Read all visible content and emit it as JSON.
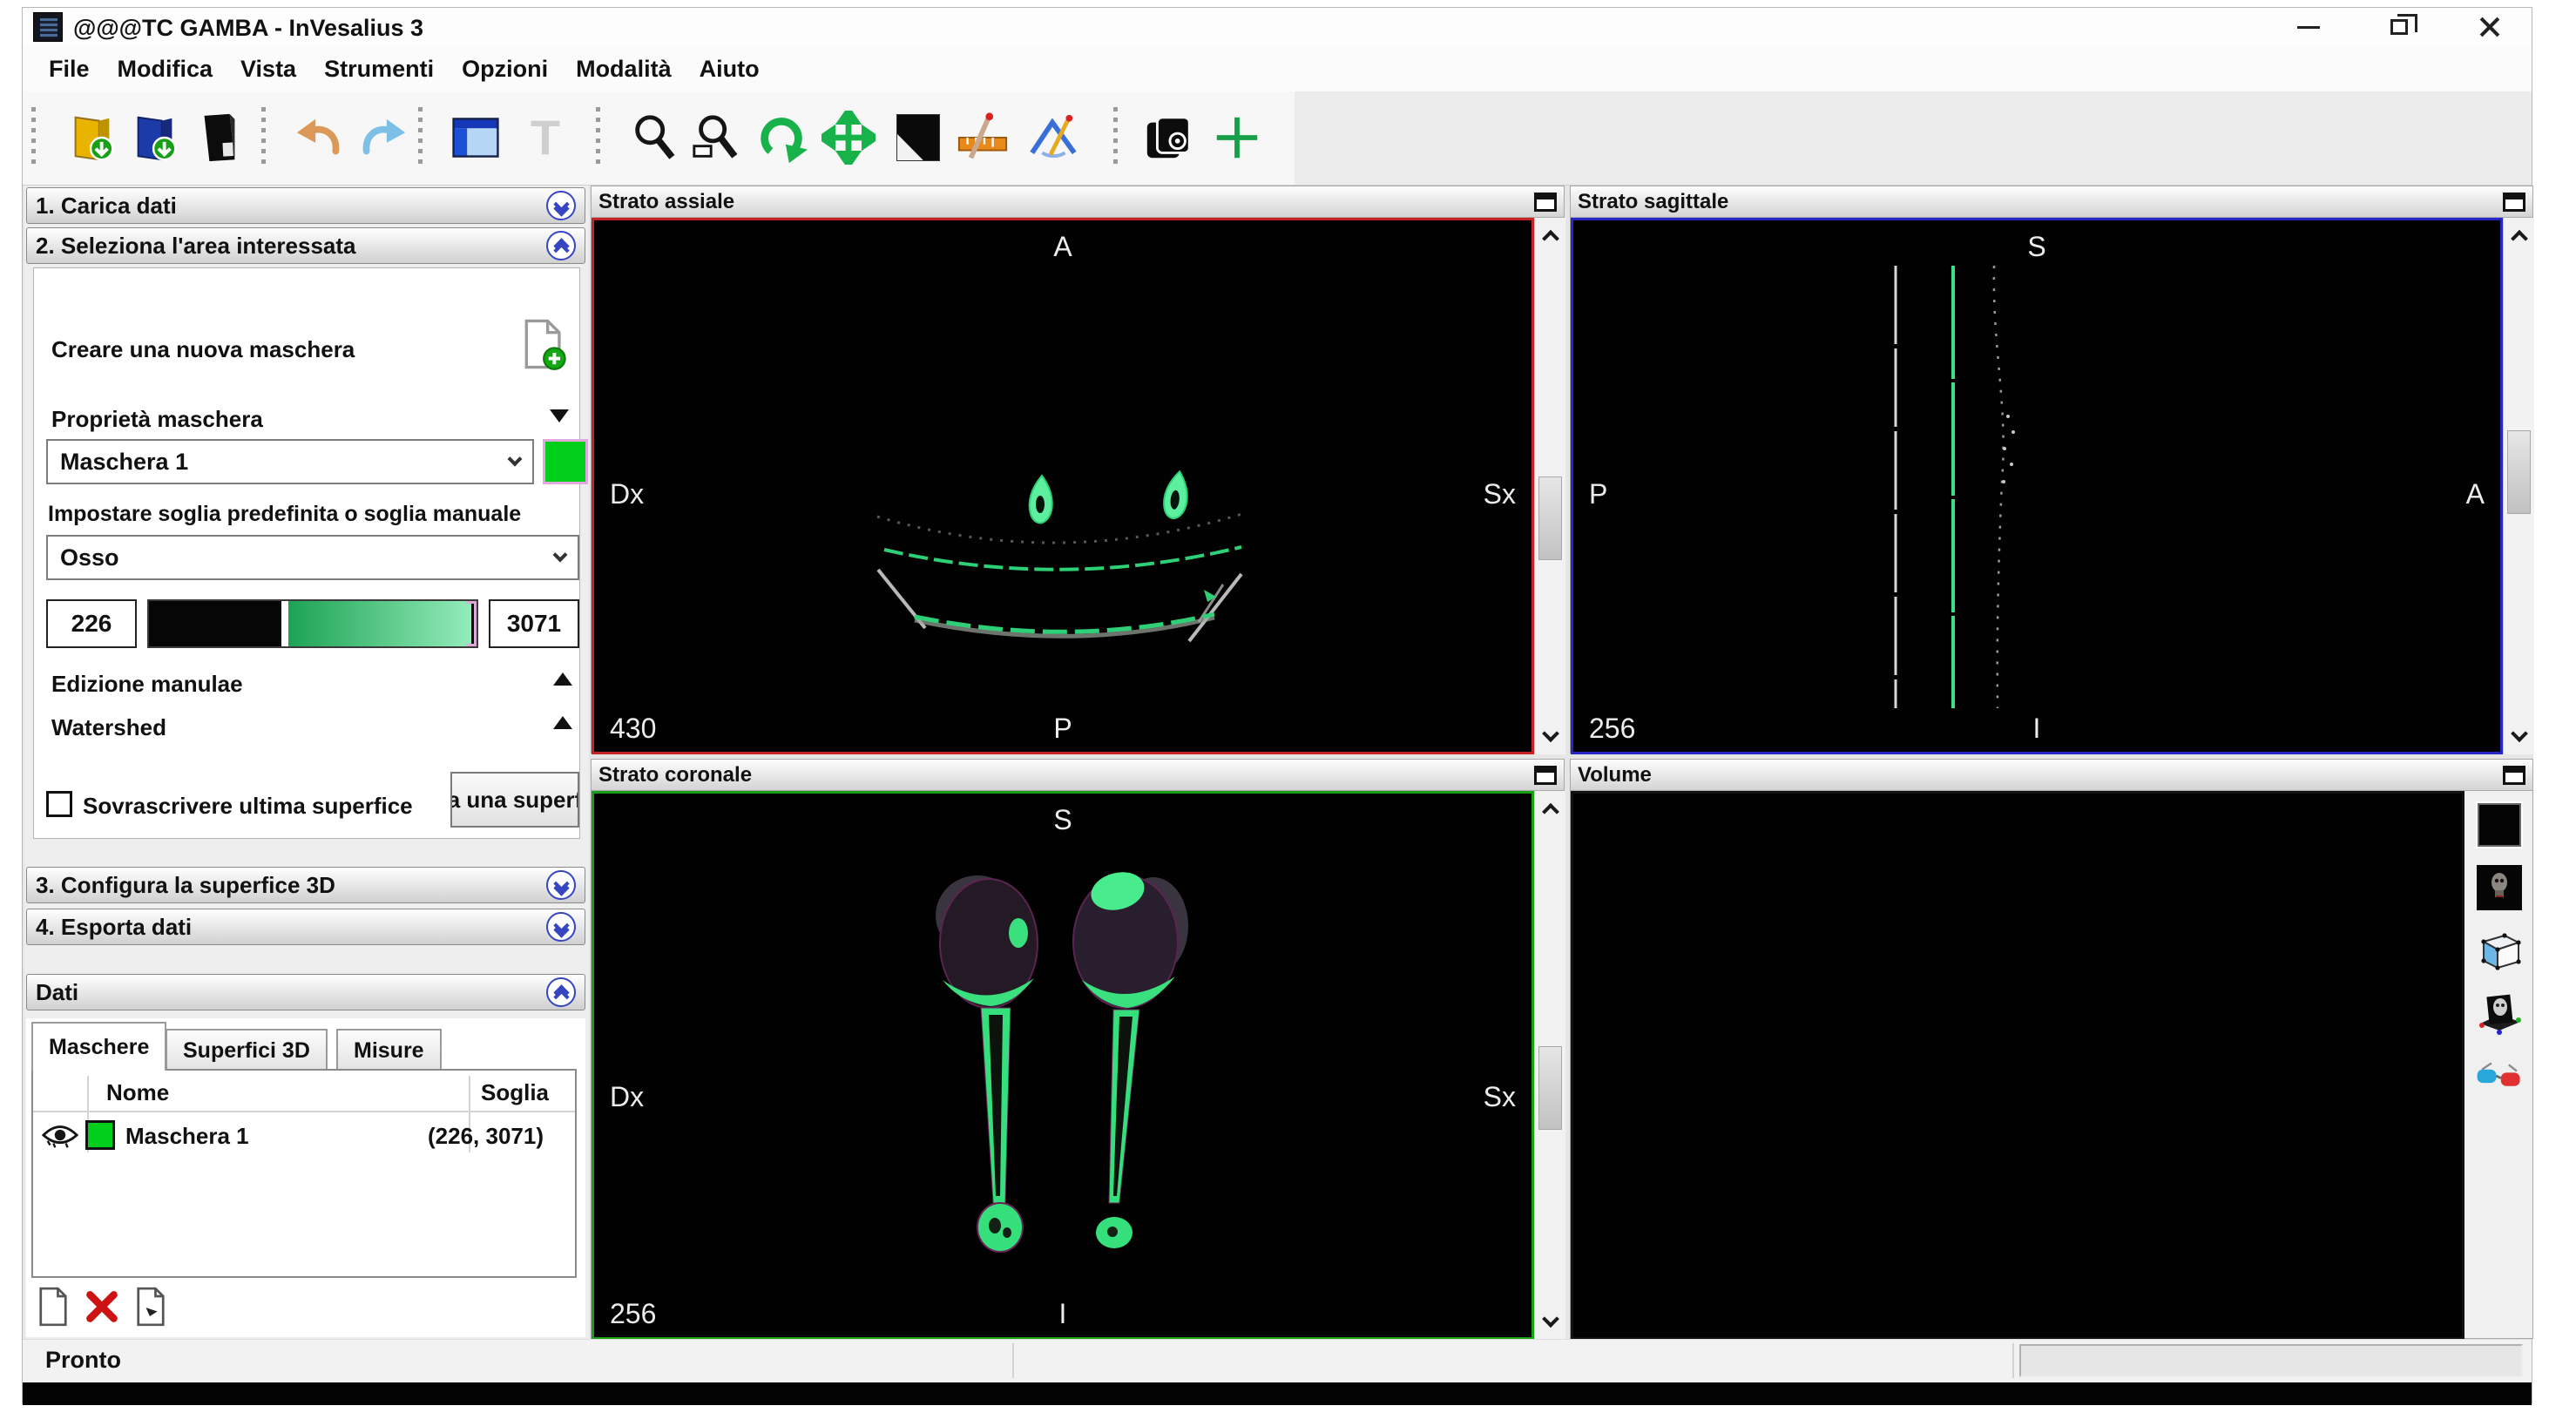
{
  "window": {
    "title": "@@@TC GAMBA - InVesalius 3"
  },
  "menu": {
    "items": [
      "File",
      "Modifica",
      "Vista",
      "Strumenti",
      "Opzioni",
      "Modalità",
      "Aiuto"
    ]
  },
  "toolbar": {
    "icons": [
      "import-dicom",
      "open-project",
      "save-project",
      "undo",
      "redo",
      "window-layout",
      "text-annotation",
      "zoom",
      "zoom-region",
      "rotate",
      "pan",
      "brightness-contrast",
      "measure-distance",
      "measure-angle",
      "slices-view",
      "crosshair-add"
    ]
  },
  "sidebar": {
    "step1": {
      "label": "1. Carica dati"
    },
    "step2": {
      "label": "2. Seleziona l'area interessata"
    },
    "step3": {
      "label": "3. Configura la superfice 3D"
    },
    "step4": {
      "label": "4. Esporta dati"
    },
    "mask": {
      "create_label": "Creare una nuova maschera",
      "properties_label": "Proprietà maschera",
      "mask_name": "Maschera 1",
      "threshold_hint": "Impostare soglia predefinita o soglia manuale",
      "preset": "Osso",
      "threshold_min": "226",
      "threshold_max": "3071",
      "manual_edition_label": "Edizione manulae",
      "watershed_label": "Watershed",
      "overwrite_label": "Sovrascrivere ultima superfice",
      "create_surface_button": "a una superf"
    },
    "data": {
      "label": "Dati",
      "tabs": [
        "Maschere",
        "Superfici 3D",
        "Misure"
      ],
      "columns": [
        "Nome",
        "Soglia"
      ],
      "rows": [
        {
          "name": "Maschera 1",
          "threshold": "(226, 3071)"
        }
      ]
    }
  },
  "viewports": {
    "axial": {
      "title": "Strato assiale",
      "slice": "430",
      "top": "A",
      "bottom": "P",
      "left": "Dx",
      "right": "Sx"
    },
    "sagittal": {
      "title": "Strato sagittale",
      "slice": "256",
      "top": "S",
      "bottom": "I",
      "left": "P",
      "right": "A"
    },
    "coronal": {
      "title": "Strato coronale",
      "slice": "256",
      "top": "S",
      "bottom": "I",
      "left": "Dx",
      "right": "Sx"
    },
    "volume": {
      "title": "Volume"
    }
  },
  "statusbar": {
    "text": "Pronto"
  },
  "colors": {
    "mask_green": "#00d01c",
    "axial_border": "#c82222",
    "sagittal_border": "#2626c8",
    "coronal_border": "#15a015",
    "bone_green": "#3ae07e"
  }
}
